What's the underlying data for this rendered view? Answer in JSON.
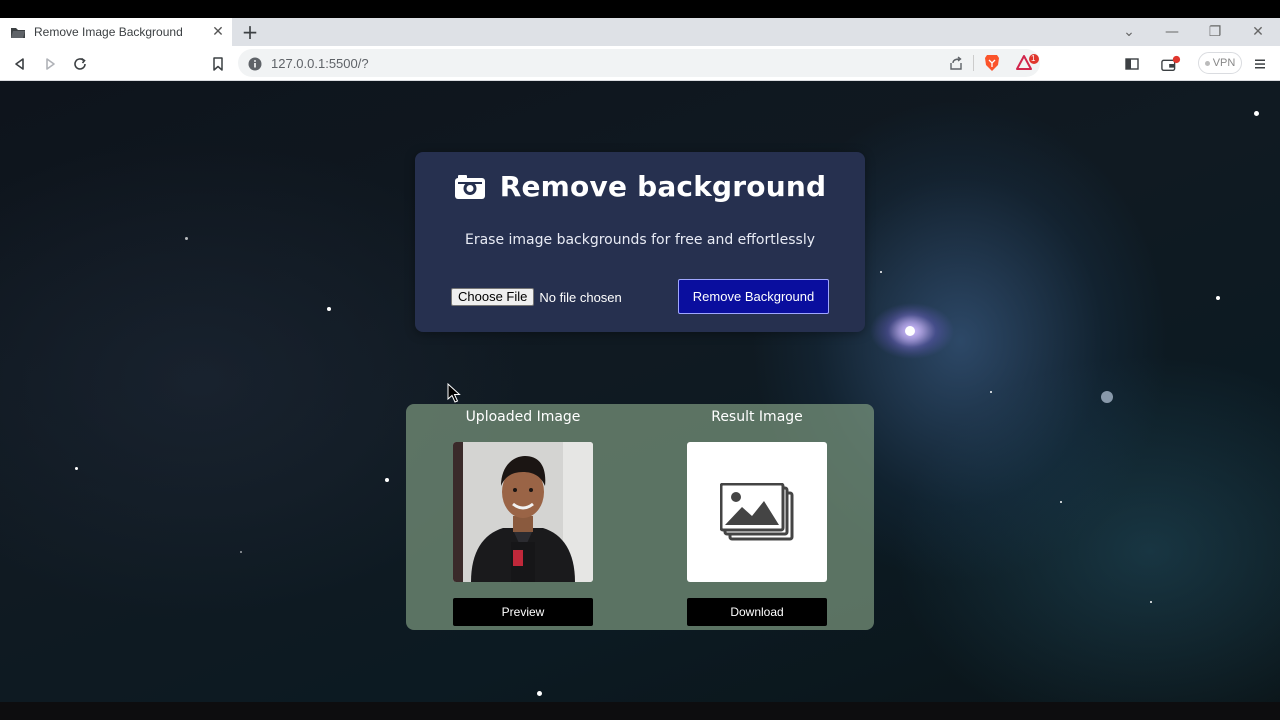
{
  "browser": {
    "tab_title": "Remove Image Background",
    "tab_close": "✕",
    "new_tab": "+",
    "url": "127.0.0.1:5500/?",
    "vpn_label": "VPN",
    "rewards_badge": "1",
    "window_controls": {
      "chevron": "⌄",
      "minimize": "—",
      "restore": "❐",
      "close": "✕"
    }
  },
  "app": {
    "title": "Remove background",
    "subtitle": "Erase image backgrounds for free and effortlessly",
    "file_input": {
      "button_label": "Choose File",
      "status": "No file chosen"
    },
    "remove_button": "Remove Background",
    "uploaded": {
      "heading": "Uploaded Image",
      "button": "Preview"
    },
    "result": {
      "heading": "Result Image",
      "button": "Download"
    }
  },
  "colors": {
    "top_card": "#26304f",
    "remove_button": "#0a0e9e",
    "result_card": "#7a967d",
    "card_button": "#000000"
  },
  "icons": [
    "tab-favicon",
    "back-icon",
    "forward-icon",
    "reload-icon",
    "bookmark-icon",
    "info-icon",
    "share-icon",
    "brave-icon",
    "rewards-icon",
    "sidebar-icon",
    "wallet-icon",
    "menu-icon",
    "camera-icon",
    "image-placeholder-icon"
  ]
}
